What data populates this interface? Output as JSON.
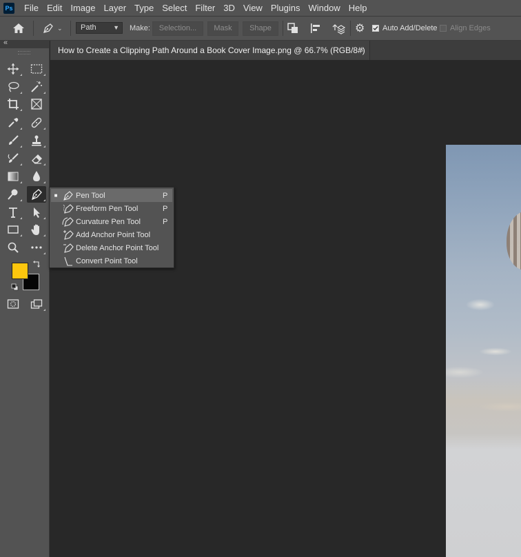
{
  "app": {
    "logo_text": "Ps"
  },
  "menubar": {
    "items": [
      "File",
      "Edit",
      "Image",
      "Layer",
      "Type",
      "Select",
      "Filter",
      "3D",
      "View",
      "Plugins",
      "Window",
      "Help"
    ]
  },
  "options": {
    "mode_value": "Path",
    "make_label": "Make:",
    "selection_label": "Selection...",
    "mask_label": "Mask",
    "shape_label": "Shape",
    "auto_add_delete_label": "Auto Add/Delete",
    "auto_add_delete_checked": true,
    "align_edges_label": "Align Edges",
    "align_edges_checked": false
  },
  "document": {
    "tab_title": "How to Create a Clipping Path Around a Book Cover Image.png @ 66.7% (RGB/8#)",
    "close_glyph": "×"
  },
  "colors": {
    "foreground": "#fcc60e",
    "background": "#050505",
    "ui_panel": "#535353",
    "canvas": "#282828"
  },
  "flyout": {
    "items": [
      {
        "label": "Pen Tool",
        "shortcut": "P",
        "selected": true,
        "icon": "pen-icon"
      },
      {
        "label": "Freeform Pen Tool",
        "shortcut": "P",
        "selected": false,
        "icon": "freeform-pen-icon"
      },
      {
        "label": "Curvature Pen Tool",
        "shortcut": "P",
        "selected": false,
        "icon": "curvature-pen-icon"
      },
      {
        "label": "Add Anchor Point Tool",
        "shortcut": "",
        "selected": false,
        "icon": "add-anchor-point-icon"
      },
      {
        "label": "Delete Anchor Point Tool",
        "shortcut": "",
        "selected": false,
        "icon": "delete-anchor-point-icon"
      },
      {
        "label": "Convert Point Tool",
        "shortcut": "",
        "selected": false,
        "icon": "convert-point-icon"
      }
    ]
  }
}
